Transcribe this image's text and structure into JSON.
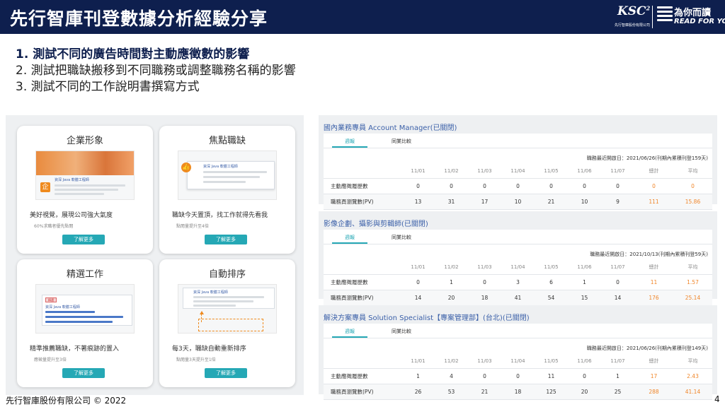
{
  "header": {
    "title": "先行智庫刊登數據分析經驗分享",
    "logo_ksc": "KSC",
    "logo_ksc_sup": "2",
    "logo_ksc_sub": "先行智庫股份有限公司",
    "logo_rfy_cn": "為你而讀",
    "logo_rfy_en": "READ FOR YOU"
  },
  "bullets": [
    {
      "text": "1. 測試不同的廣告時間對主動應徵數的影響"
    },
    {
      "text": "2. 測試把職缺搬移到不同職務或調整職務名稱的影響"
    },
    {
      "text": "3. 測試不同的工作說明書撰寫方式"
    }
  ],
  "cards": [
    {
      "title": "企業形象",
      "desc": "美好視覺，展現公司強大氣度",
      "sub": "60%求職者優先點閱",
      "button": "了解更多",
      "img_label": "資深 Java 軟體工程師",
      "badge": "企"
    },
    {
      "title": "焦點職缺",
      "desc": "職缺今天置頂，找工作就得先看我",
      "sub": "點閱量提升至4倍",
      "button": "了解更多",
      "img_label": "資深 Java 軟體工程師"
    },
    {
      "title": "精選工作",
      "desc": "精準推薦職缺，不著痕跡的置入",
      "sub": "應徵量提升至3倍",
      "button": "了解更多",
      "img_label": "資深 Java 軟體工程師",
      "tag": "精選"
    },
    {
      "title": "自動排序",
      "desc": "每3天，職缺自動重新排序",
      "sub": "點閱量3天提升至1倍",
      "button": "了解更多",
      "img_label": "資深 Java 軟體工程師"
    }
  ],
  "tabs": {
    "weekly": "週報",
    "compare": "同業比較"
  },
  "columns": [
    "",
    "11/01",
    "11/02",
    "11/03",
    "11/04",
    "11/05",
    "11/06",
    "11/07",
    "總計",
    "平均"
  ],
  "jobs": [
    {
      "title": "國內業務專員 Account Manager(已關閉)",
      "post_info": "職務最近開啟日：2021/06/26(刊期內累積刊登159天)",
      "rows": [
        {
          "label": "主動應徵履歷數",
          "values": [
            "0",
            "0",
            "0",
            "0",
            "0",
            "0",
            "0"
          ],
          "total": "0",
          "avg": "0"
        },
        {
          "label": "職務頁瀏覽數(PV)",
          "values": [
            "13",
            "31",
            "17",
            "10",
            "21",
            "10",
            "9"
          ],
          "total": "111",
          "avg": "15.86"
        }
      ]
    },
    {
      "title": "影像企劃、攝影與剪輯師(已關閉)",
      "post_info": "職務最近開啟日：2021/10/13(刊期內累積刊登59天)",
      "rows": [
        {
          "label": "主動應徵履歷數",
          "values": [
            "0",
            "1",
            "0",
            "3",
            "6",
            "1",
            "0"
          ],
          "total": "11",
          "avg": "1.57"
        },
        {
          "label": "職務頁瀏覽數(PV)",
          "values": [
            "14",
            "20",
            "18",
            "41",
            "54",
            "15",
            "14"
          ],
          "total": "176",
          "avg": "25.14"
        }
      ]
    },
    {
      "title": "解決方案專員 Solution Specialist【專案管理部】(台北)(已關閉)",
      "post_info": "職務最近開啟日：2021/06/26(刊期內累積刊登149天)",
      "rows": [
        {
          "label": "主動應徵履歷數",
          "values": [
            "1",
            "4",
            "0",
            "0",
            "11",
            "0",
            "1"
          ],
          "total": "17",
          "avg": "2.43"
        },
        {
          "label": "職務頁瀏覽數(PV)",
          "values": [
            "26",
            "53",
            "21",
            "18",
            "125",
            "20",
            "25"
          ],
          "total": "288",
          "avg": "41.14"
        }
      ]
    }
  ],
  "footer": {
    "copyright": "先行智庫股份有限公司 © 2022",
    "page": "4"
  },
  "colors": {
    "navy": "#0e1f4e",
    "teal": "#25a8b5",
    "orange": "#f0862a",
    "link_blue": "#3a5fa8"
  }
}
